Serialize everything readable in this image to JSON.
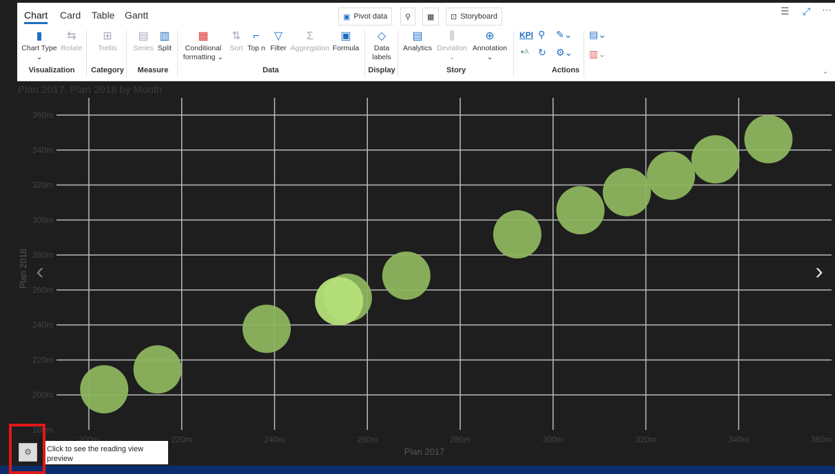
{
  "tabs": [
    "Chart",
    "Card",
    "Table",
    "Gantt"
  ],
  "top_buttons": {
    "pivot": "Pivot data",
    "storyboard": "Storyboard"
  },
  "buttons": {
    "chart_type": "Chart Type",
    "rotate": "Rotate",
    "trellis": "Trellis",
    "series": "Series",
    "split": "Split",
    "cond1": "Conditional",
    "cond2": "formatting",
    "sort": "Sort",
    "topn": "Top n",
    "filter": "Filter",
    "aggregation": "Aggregation",
    "formula": "Formula",
    "data1": "Data",
    "data2": "labels",
    "analytics": "Analytics",
    "deviation": "Deviation",
    "annotation": "Annotation",
    "kpi": "KPI"
  },
  "groups": {
    "visualization": "Visualization",
    "category": "Category",
    "measure": "Measure",
    "data": "Data",
    "display": "Display",
    "story": "Story",
    "actions": "Actions"
  },
  "tooltip": "Click to see the reading view preview",
  "chart_data": {
    "type": "scatter",
    "title": "Plan 2017, Plan 2018 by Month",
    "xlabel": "Plan 2017",
    "ylabel": "Plan 2018",
    "xlim": [
      200,
      360
    ],
    "ylim": [
      180,
      360
    ],
    "xticks": [
      "200m",
      "220m",
      "240m",
      "260m",
      "280m",
      "300m",
      "320m",
      "340m",
      "360m"
    ],
    "yticks": [
      "180m",
      "200m",
      "220m",
      "240m",
      "260m",
      "280m",
      "300m",
      "320m",
      "340m",
      "360m"
    ],
    "points": [
      [
        203.3,
        203.2
      ],
      [
        214.8,
        214.6
      ],
      [
        238.3,
        237.8
      ],
      [
        255.8,
        255.6
      ],
      [
        253.9,
        253.6
      ],
      [
        268.4,
        268.2
      ],
      [
        292.3,
        291.8
      ],
      [
        305.9,
        305.6
      ],
      [
        315.9,
        315.9
      ],
      [
        325.4,
        325.3
      ],
      [
        335.0,
        334.7
      ],
      [
        346.4,
        346.2
      ]
    ],
    "highlighted_index": 4,
    "color": "#8db55e",
    "highlight_color": "#b5e07a",
    "grid": true
  }
}
